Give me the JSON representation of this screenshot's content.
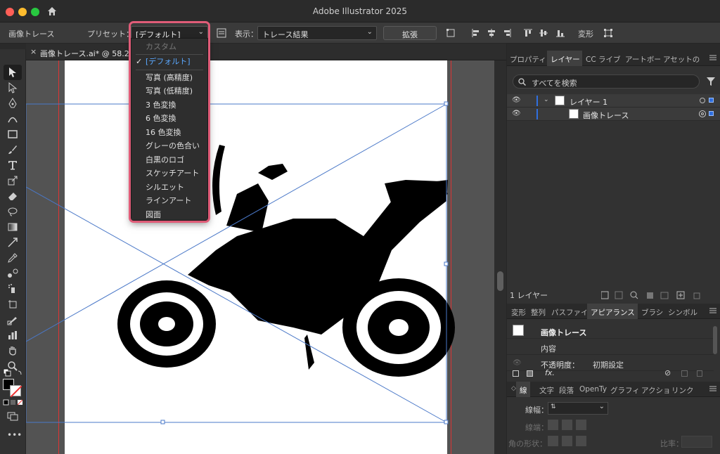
{
  "app": {
    "title": "Adobe Illustrator 2025"
  },
  "control_bar": {
    "panel_name": "画像トレース",
    "preset_label": "プリセット：",
    "preset_value": "[デフォルト]",
    "view_label": "表示：",
    "view_value": "トレース結果",
    "expand_label": "拡張",
    "transform_label": "変形"
  },
  "document": {
    "tab_title": "画像トレース.ai* @ 58.23 %"
  },
  "preset_menu": {
    "items": [
      {
        "label": "カスタム",
        "state": "disabled"
      },
      {
        "label": "[デフォルト]",
        "state": "selected"
      },
      {
        "label": "写真 (高精度)",
        "state": "normal"
      },
      {
        "label": "写真 (低精度)",
        "state": "normal"
      },
      {
        "label": "3 色変換",
        "state": "normal"
      },
      {
        "label": "6 色変換",
        "state": "normal"
      },
      {
        "label": "16 色変換",
        "state": "normal"
      },
      {
        "label": "グレーの色合い",
        "state": "normal"
      },
      {
        "label": "白黒のロゴ",
        "state": "normal"
      },
      {
        "label": "スケッチアート",
        "state": "normal"
      },
      {
        "label": "シルエット",
        "state": "normal"
      },
      {
        "label": "ラインアート",
        "state": "normal"
      },
      {
        "label": "図面",
        "state": "normal"
      }
    ]
  },
  "layers_panel": {
    "tabs": [
      "プロパティ",
      "レイヤー",
      "CC ライブ",
      "アートボー",
      "アセットの"
    ],
    "search_placeholder": "すべてを検索",
    "layers": [
      {
        "name": "レイヤー 1"
      },
      {
        "name": "画像トレース"
      }
    ],
    "footer": "1 レイヤー"
  },
  "appearance_panel": {
    "tabs": [
      "変形",
      "整列",
      "パスファイ",
      "アピアランス",
      "ブラシ",
      "シンボル"
    ],
    "object_name": "画像トレース",
    "contents_label": "内容",
    "opacity_label": "不透明度：",
    "opacity_value": "初期設定",
    "fx_label": "fx."
  },
  "stroke_panel": {
    "tabs": [
      "線",
      "文字",
      "段落",
      "OpenTy",
      "グラフィ",
      "アクショ",
      "リンク"
    ],
    "weight_label": "線幅：",
    "cap_label": "線端：",
    "corner_label": "角の形状：",
    "ratio_label": "比率："
  },
  "colors": {
    "highlight": "#e05c78",
    "selection": "#4a78c8",
    "accent": "#2f8cf0"
  }
}
